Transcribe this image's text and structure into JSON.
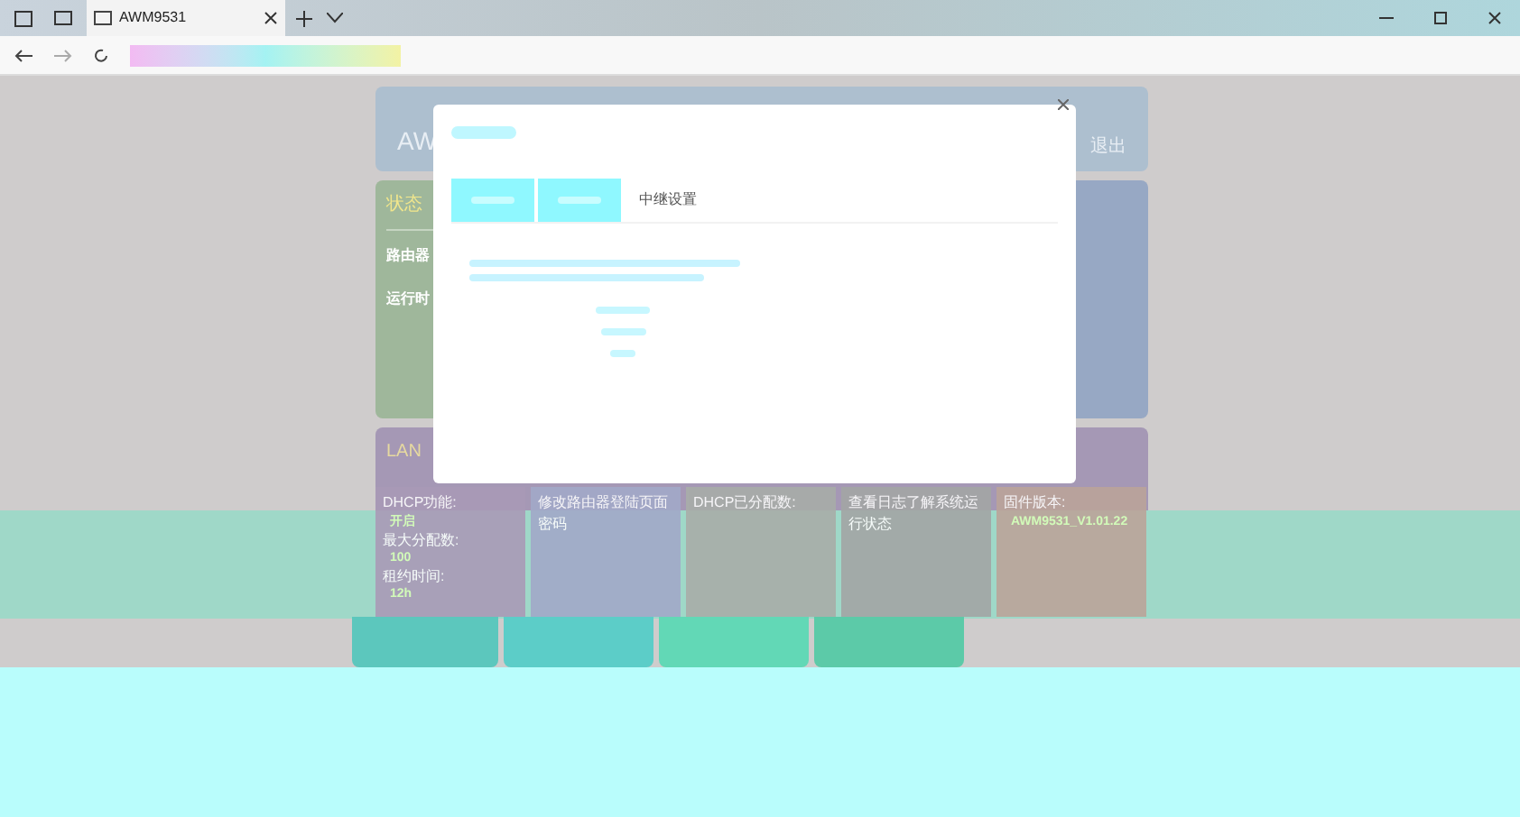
{
  "browser": {
    "tab_title": "AWM9531"
  },
  "header": {
    "brand": "AW",
    "links": [
      "退出"
    ]
  },
  "status_card": {
    "title": "状态",
    "items": [
      "路由器",
      "运行时"
    ]
  },
  "modal": {
    "tabs": [
      {
        "kind": "button"
      },
      {
        "kind": "button"
      },
      {
        "kind": "text",
        "label": "中继设置"
      }
    ]
  },
  "lan_card": {
    "title": "LAN"
  },
  "tiles": [
    {
      "label": "DHCP功能:",
      "value": "开启"
    },
    {
      "label": "修改路由器登陆页面密码"
    },
    {
      "label": "DHCP已分配数:"
    },
    {
      "label": "查看日志了解系统运行状态"
    },
    {
      "label": "固件版本:",
      "value": "AWM9531_V1.01.22"
    }
  ],
  "lan_items": [
    {
      "label": "最大分配数:",
      "value": "100"
    },
    {
      "label": "租约时间:",
      "value": "12h"
    }
  ]
}
